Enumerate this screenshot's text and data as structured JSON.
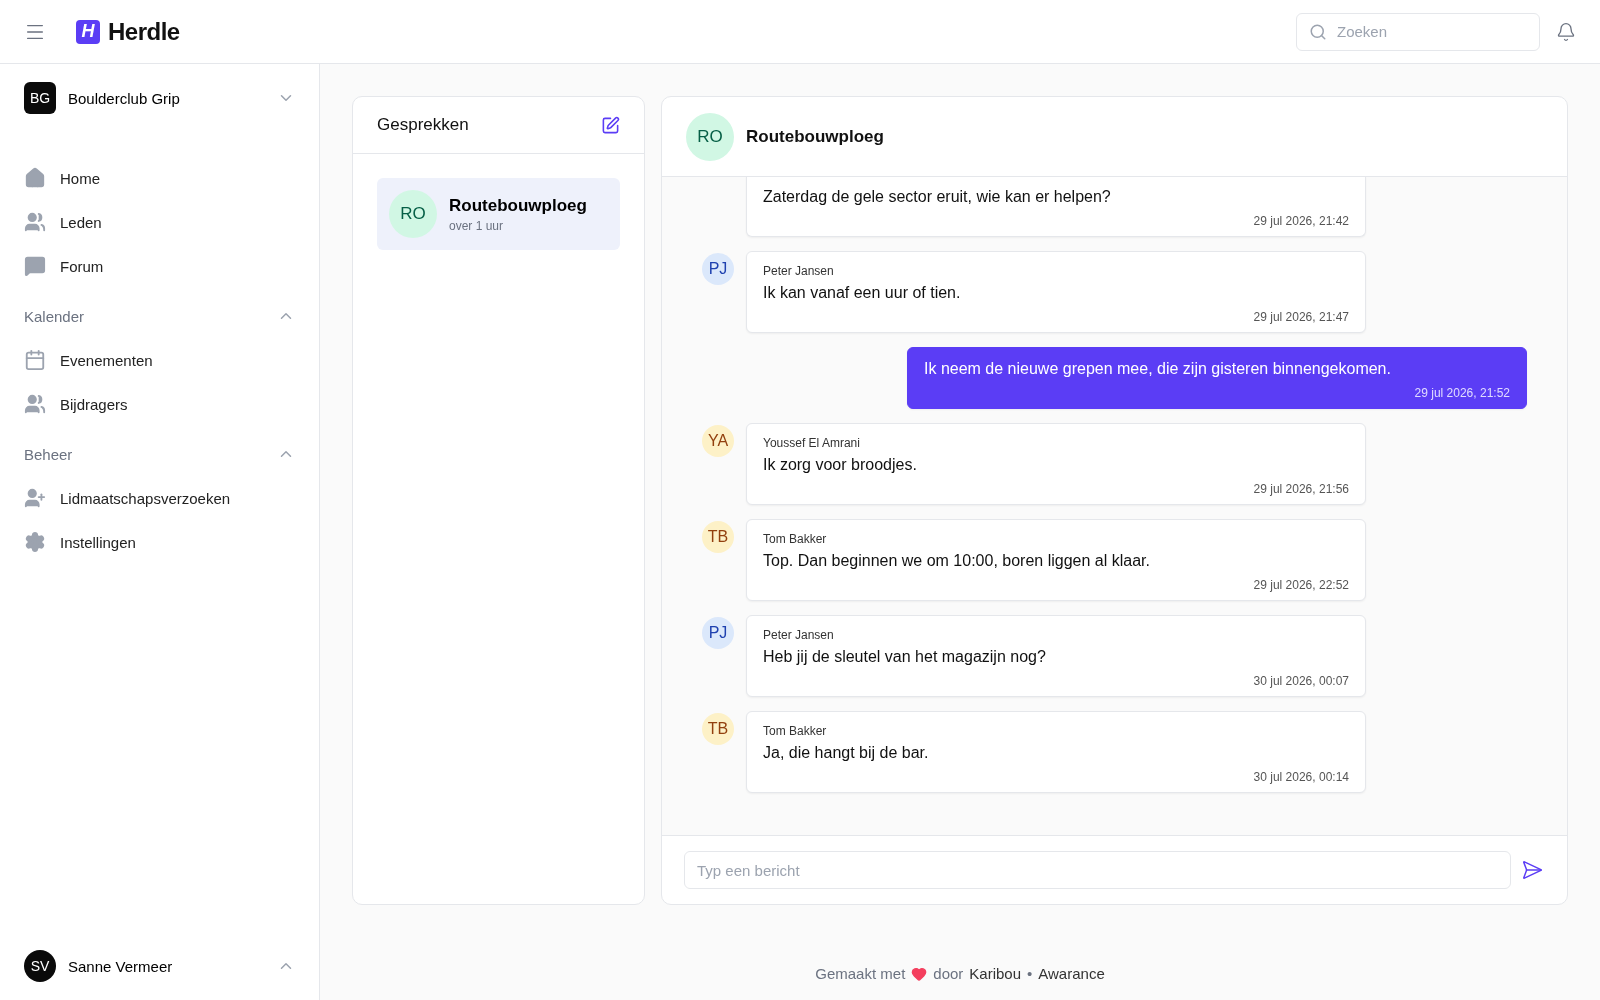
{
  "topbar": {
    "brand": "Herdle",
    "brand_mark": "H",
    "search": {
      "placeholder": "Zoeken"
    }
  },
  "sidebar": {
    "org": {
      "initials": "BG",
      "name": "Boulderclub Grip",
      "expanded": false
    },
    "items": [
      {
        "label": "Home"
      },
      {
        "label": "Leden"
      },
      {
        "label": "Forum"
      }
    ],
    "sections": [
      {
        "title": "Kalender",
        "expanded": true,
        "items": [
          {
            "label": "Evenementen"
          },
          {
            "label": "Bijdragers"
          }
        ]
      },
      {
        "title": "Beheer",
        "expanded": true,
        "items": [
          {
            "label": "Lidmaatschapsverzoeken"
          },
          {
            "label": "Instellingen"
          }
        ]
      }
    ],
    "user": {
      "initials": "SV",
      "name": "Sanne Vermeer",
      "expanded": true
    }
  },
  "conversations": {
    "title": "Gesprekken",
    "items": [
      {
        "initials": "RO",
        "name": "Routebouwploeg",
        "time": "over 1 uur",
        "selected": true
      }
    ]
  },
  "chat": {
    "initials": "RO",
    "title": "Routebouwploeg",
    "messages": [
      {
        "kind": "other",
        "text": "Zaterdag de gele sector eruit, wie kan er helpen?",
        "time": "29 jul 2026, 21:42"
      },
      {
        "kind": "other",
        "initials": "PJ",
        "color": "#dbe8fb",
        "sender": "Peter Jansen",
        "text": "Ik kan vanaf een uur of tien.",
        "time": "29 jul 2026, 21:47"
      },
      {
        "kind": "own",
        "text": "Ik neem de nieuwe grepen mee, die zijn gisteren binnengekomen.",
        "time": "29 jul 2026, 21:52"
      },
      {
        "kind": "other",
        "initials": "YA",
        "color": "#fdf1c7",
        "sender": "Youssef El Amrani",
        "text": "Ik zorg voor broodjes.",
        "time": "29 jul 2026, 21:56"
      },
      {
        "kind": "other",
        "initials": "TB",
        "color": "#fdf1c7",
        "sender": "Tom Bakker",
        "text": "Top. Dan beginnen we om 10:00, boren liggen al klaar.",
        "time": "29 jul 2026, 22:52"
      },
      {
        "kind": "other",
        "initials": "PJ",
        "color": "#dbe8fb",
        "sender": "Peter Jansen",
        "text": "Heb jij de sleutel van het magazijn nog?",
        "time": "30 jul 2026, 00:07"
      },
      {
        "kind": "other",
        "initials": "TB",
        "color": "#fdf1c7",
        "sender": "Tom Bakker",
        "text": "Ja, die hangt bij de bar.",
        "time": "30 jul 2026, 00:14"
      }
    ],
    "composer": {
      "placeholder": "Typ een bericht"
    }
  },
  "footer": {
    "prefix": "Gemaakt met",
    "middle": "door",
    "link_1": "Karibou",
    "separator": "•",
    "link_2": "Awarance"
  }
}
